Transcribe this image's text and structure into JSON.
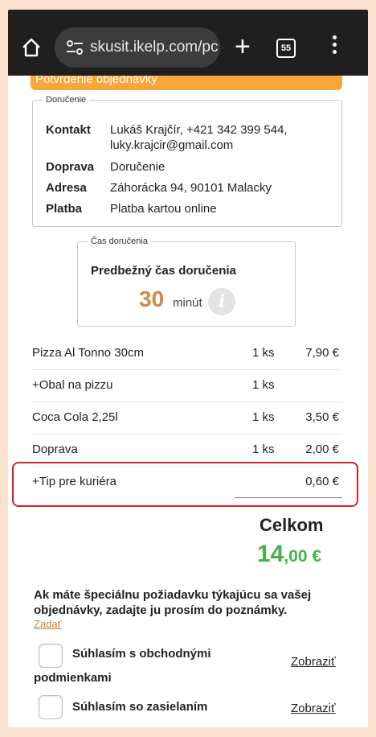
{
  "browser": {
    "url": "skusit.ikelp.com/pc",
    "tab_count": "55"
  },
  "banner": {
    "text": "Potvrdenie objednávky"
  },
  "delivery": {
    "legend": "Doručenie",
    "contact_label": "Kontakt",
    "contact_line1": "Lukáš Krajčír, +421 342 399 544,",
    "contact_line2": "luky.krajcir@gmail.com",
    "transport_label": "Doprava",
    "transport_value": "Doručenie",
    "address_label": "Adresa",
    "address_value": "Záhorácka 94, 90101 Malacky",
    "payment_label": "Platba",
    "payment_value": "Platba kartou online"
  },
  "delivery_time": {
    "legend": "Čas doručenia",
    "title": "Predbežný čas doručenia",
    "minutes": "30",
    "unit": "minút",
    "info_icon": "i"
  },
  "items": [
    {
      "name": "Pizza Al Tonno 30cm",
      "qty": "1 ks",
      "price": "7,90 €"
    },
    {
      "name": "+Obal na pizzu",
      "qty": "1 ks",
      "price": ""
    },
    {
      "name": "Coca Cola 2,25l",
      "qty": "1 ks",
      "price": "3,50 €"
    },
    {
      "name": "Doprava",
      "qty": "1 ks",
      "price": "2,00 €"
    },
    {
      "name": "+Tip pre kuriéra",
      "qty": "",
      "price": "0,60 €"
    }
  ],
  "total": {
    "label": "Celkom",
    "whole": "14",
    "fraction": ",00 €"
  },
  "note": {
    "text": "Ak máte špeciálnu požiadavku týkajúcu sa vašej objednávky, zadajte ju prosím do poznámky.",
    "link": "Zadať"
  },
  "agreements": [
    {
      "label_line1": "Súhlasím s obchodnými",
      "label_line2": "podmienkami",
      "link": "Zobraziť"
    },
    {
      "label_line1": "Súhlasím so zasielaním",
      "link": "Zobraziť"
    }
  ],
  "colors": {
    "accent_orange": "#f7a63a",
    "total_green": "#46b24a",
    "highlight_red": "#d0202a"
  }
}
